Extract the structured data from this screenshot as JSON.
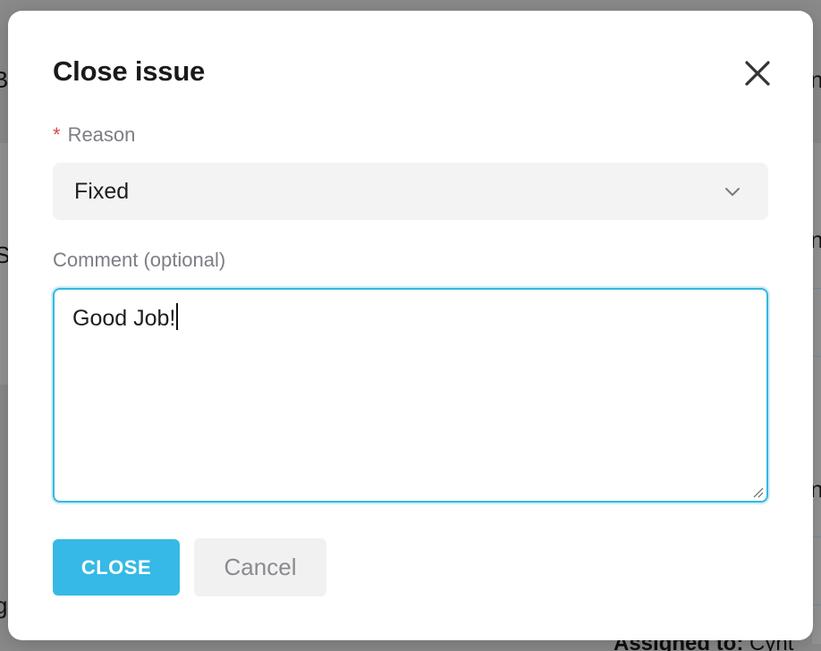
{
  "background": {
    "fragments": [
      "B",
      "S",
      "g",
      "n",
      "n",
      "n"
    ],
    "assigned_label": "Assigned to:",
    "assigned_value": "Cynt"
  },
  "modal": {
    "title": "Close issue",
    "close_icon": "close-icon",
    "reason": {
      "required_mark": "*",
      "label": "Reason",
      "value": "Fixed",
      "icon": "chevron-down-icon"
    },
    "comment": {
      "label": "Comment (optional)",
      "value": "Good Job!"
    },
    "buttons": {
      "close_label": "CLOSE",
      "cancel_label": "Cancel"
    }
  },
  "colors": {
    "primary": "#36b9e6",
    "required": "#e04848",
    "focus_border": "#36b7e0",
    "overlay": "#8c8c8c"
  }
}
